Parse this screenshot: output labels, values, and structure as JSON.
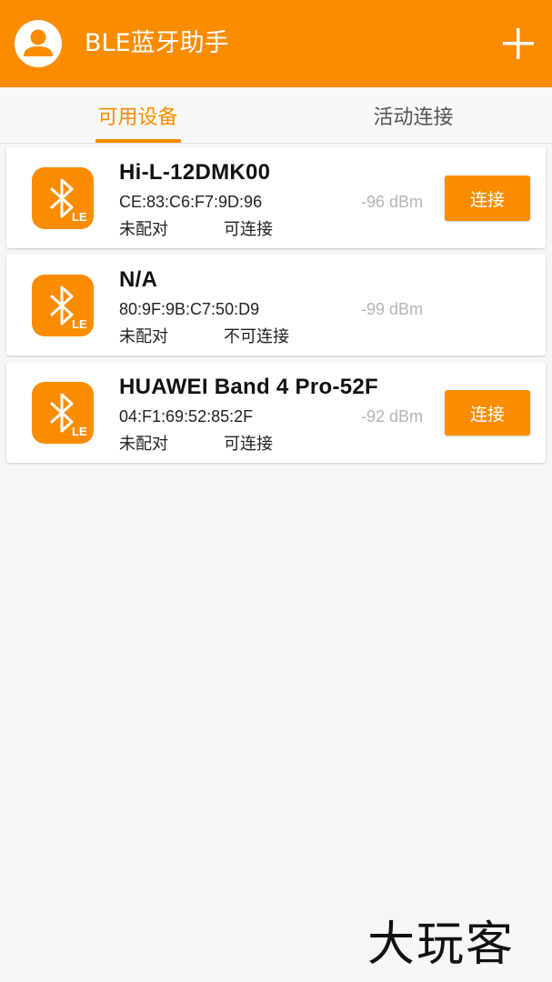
{
  "appbar": {
    "title": "BLE蓝牙助手",
    "avatar_icon": "user-avatar-icon",
    "add_icon": "plus-icon",
    "accent_color": "#fb8c00"
  },
  "tabs": [
    {
      "label": "可用设备",
      "active": true
    },
    {
      "label": "活动连接",
      "active": false
    }
  ],
  "devices": [
    {
      "name": "Hi-L-12DMK00",
      "mac": "CE:83:C6:F7:9D:96",
      "pairing": "未配对",
      "connectable": "可连接",
      "rssi": "-96 dBm",
      "button": "连接",
      "icon": "bluetooth-le-icon"
    },
    {
      "name": "N/A",
      "mac": "80:9F:9B:C7:50:D9",
      "pairing": "未配对",
      "connectable": "不可连接",
      "rssi": "-99 dBm",
      "button": null,
      "icon": "bluetooth-le-icon"
    },
    {
      "name": "HUAWEI Band 4 Pro-52F",
      "mac": "04:F1:69:52:85:2F",
      "pairing": "未配对",
      "connectable": "可连接",
      "rssi": "-92 dBm",
      "button": "连接",
      "icon": "bluetooth-le-icon"
    }
  ],
  "watermark": "大玩客"
}
